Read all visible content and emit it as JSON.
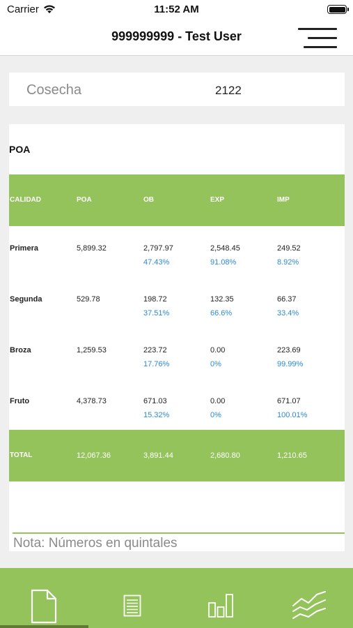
{
  "status_bar": {
    "carrier": "Carrier",
    "time": "11:52 AM"
  },
  "nav": {
    "title": "999999999 - Test User"
  },
  "cosecha": {
    "label": "Cosecha",
    "value": "2122"
  },
  "poa": {
    "title": "POA",
    "headers": [
      "CALIDAD",
      "POA",
      "OB",
      "EXP",
      "IMP"
    ],
    "rows": [
      {
        "calidad": "Primera",
        "poa": "5,899.32",
        "ob": "2,797.97",
        "ob_pct": "47.43%",
        "exp": "2,548.45",
        "exp_pct": "91.08%",
        "imp": "249.52",
        "imp_pct": "8.92%"
      },
      {
        "calidad": "Segunda",
        "poa": "529.78",
        "ob": "198.72",
        "ob_pct": "37.51%",
        "exp": "132.35",
        "exp_pct": "66.6%",
        "imp": "66.37",
        "imp_pct": "33.4%"
      },
      {
        "calidad": "Broza",
        "poa": "1,259.53",
        "ob": "223.72",
        "ob_pct": "17.76%",
        "exp": "0.00",
        "exp_pct": "0%",
        "imp": "223.69",
        "imp_pct": "99.99%"
      },
      {
        "calidad": "Fruto",
        "poa": "4,378.73",
        "ob": "671.03",
        "ob_pct": "15.32%",
        "exp": "0.00",
        "exp_pct": "0%",
        "imp": "671.07",
        "imp_pct": "100.01%"
      }
    ],
    "total": {
      "label": "TOTAL",
      "poa": "12,067.36",
      "ob": "3,891.44",
      "exp": "2,680.80",
      "imp": "1,210.65"
    },
    "note": "Nota: Números en quintales"
  },
  "tabs": [
    {
      "icon": "document-icon",
      "selected": true
    },
    {
      "icon": "list-icon",
      "selected": false
    },
    {
      "icon": "bar-chart-icon",
      "selected": false
    },
    {
      "icon": "trend-lines-icon",
      "selected": false
    }
  ],
  "colors": {
    "accent": "#93c35a",
    "percent": "#2b8ad6",
    "indicator": "#5e7a34"
  }
}
